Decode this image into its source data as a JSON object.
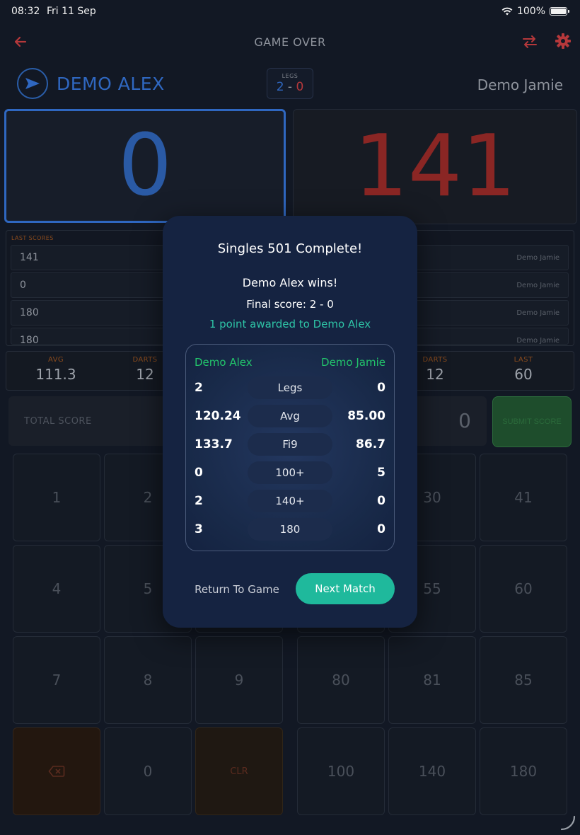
{
  "status_bar": {
    "time": "08:32",
    "date": "Fri 11 Sep",
    "battery": "100%"
  },
  "header": {
    "title": "GAME OVER"
  },
  "players": {
    "p1": {
      "name": "DEMO ALEX",
      "score": "0"
    },
    "p2": {
      "name": "Demo Jamie",
      "score": "141"
    }
  },
  "legs": {
    "label": "LEGS",
    "p1": "2",
    "sep": "-",
    "p2": "0"
  },
  "last_scores": {
    "label": "LAST SCORES",
    "p1": [
      "141",
      "0",
      "180",
      "180"
    ],
    "p2": [
      "Demo Jamie",
      "Demo Jamie",
      "Demo Jamie",
      "Demo Jamie"
    ]
  },
  "stats": {
    "p1": [
      {
        "k": "AVG",
        "v": "111.3"
      },
      {
        "k": "DARTS",
        "v": "12"
      }
    ],
    "p2": [
      {
        "k": "DARTS",
        "v": "12"
      },
      {
        "k": "LAST",
        "v": "60"
      }
    ]
  },
  "input": {
    "total_label": "TOTAL SCORE",
    "value": "0",
    "submit": "SUBMIT SCORE"
  },
  "keypad": {
    "left": [
      "1",
      "2",
      "",
      "4",
      "5",
      "",
      "7",
      "8",
      "9",
      "",
      "0",
      "CLR"
    ],
    "right": [
      "",
      "30",
      "41",
      "",
      "55",
      "60",
      "80",
      "81",
      "85",
      "100",
      "140",
      "180"
    ]
  },
  "modal": {
    "title": "Singles 501 Complete!",
    "winner": "Demo Alex wins!",
    "final_score": "Final score: 2 - 0",
    "award": "1 point awarded to Demo Alex",
    "p1_name": "Demo Alex",
    "p2_name": "Demo Jamie",
    "rows": [
      {
        "label": "Legs",
        "p1": "2",
        "p2": "0"
      },
      {
        "label": "Avg",
        "p1": "120.24",
        "p2": "85.00"
      },
      {
        "label": "Fi9",
        "p1": "133.7",
        "p2": "86.7"
      },
      {
        "label": "100+",
        "p1": "0",
        "p2": "5"
      },
      {
        "label": "140+",
        "p1": "2",
        "p2": "0"
      },
      {
        "label": "180",
        "p1": "3",
        "p2": "0"
      }
    ],
    "return_label": "Return To Game",
    "next_label": "Next Match"
  },
  "colors": {
    "p1_accent": "#2f67c0",
    "p2_accent": "#b5383b",
    "win_green": "#22c46b",
    "teal": "#1fb99c"
  }
}
